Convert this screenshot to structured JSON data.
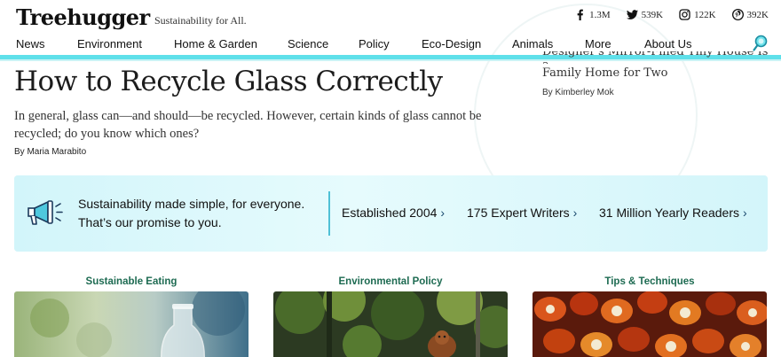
{
  "header": {
    "logo": "Treehugger",
    "tagline": "Sustainability for All.",
    "socials": [
      {
        "icon": "facebook-icon",
        "count": "1.3M"
      },
      {
        "icon": "twitter-icon",
        "count": "539K"
      },
      {
        "icon": "instagram-icon",
        "count": "122K"
      },
      {
        "icon": "pinterest-icon",
        "count": "392K"
      }
    ]
  },
  "nav": {
    "items": [
      "News",
      "Environment",
      "Home & Garden",
      "Science",
      "Policy",
      "Eco-Design",
      "Animals",
      "More",
      "About Us"
    ],
    "search_icon": "search-icon"
  },
  "hero": {
    "title": "How to Recycle Glass Correctly",
    "dek": "In general, glass can—and should—be recycled. However, certain kinds of glass cannot be recycled; do you know which ones?",
    "byline": "By Maria Marabito"
  },
  "side_article": {
    "title_cut": "Designer's Mirror-Filled Tiny House Is a",
    "title": "Family Home for Two",
    "byline": "By Kimberley Mok"
  },
  "promo": {
    "icon": "megaphone-icon",
    "line1": "Sustainability made simple, for everyone.",
    "line2": "That’s our promise to you.",
    "stats": [
      "Established 2004",
      "175 Expert Writers",
      "31 Million Yearly Readers"
    ],
    "accent": "#4fc0d6",
    "background": "#d6f6fb"
  },
  "categories": [
    {
      "label": "Sustainable Eating"
    },
    {
      "label": "Environmental Policy"
    },
    {
      "label": "Tips & Techniques"
    }
  ],
  "colors": {
    "nav_underline": "#5fe0ea",
    "category_label": "#1e6b52"
  }
}
